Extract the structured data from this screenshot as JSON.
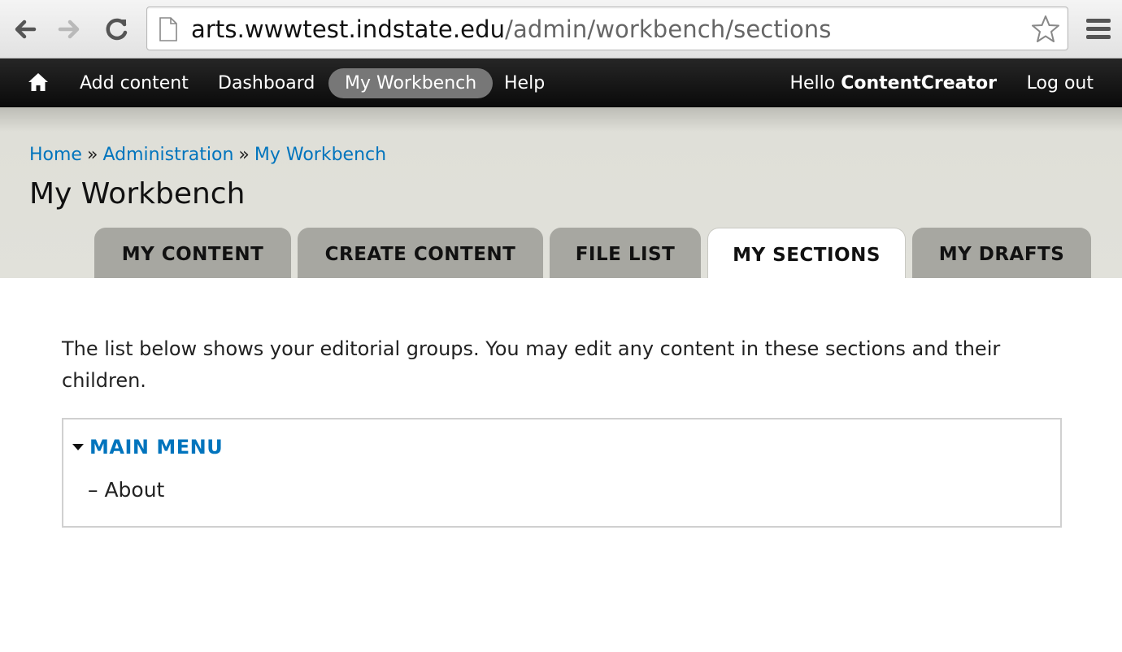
{
  "browser": {
    "url_host": "arts.wwwtest.indstate.edu",
    "url_path": "/admin/workbench/sections",
    "icons": [
      "back-arrow-icon",
      "forward-arrow-icon",
      "reload-icon",
      "page-icon",
      "star-icon",
      "hamburger-menu-icon"
    ]
  },
  "toolbar": {
    "items": [
      {
        "label": "Add content"
      },
      {
        "label": "Dashboard"
      },
      {
        "label": "My Workbench",
        "active": true
      },
      {
        "label": "Help"
      }
    ],
    "hello_prefix": "Hello",
    "username": "ContentCreator",
    "logout": "Log out"
  },
  "breadcrumb": [
    "Home",
    "Administration",
    "My Workbench"
  ],
  "breadcrumb_separator": "»",
  "page_title": "My Workbench",
  "tabs": [
    {
      "label": "MY CONTENT"
    },
    {
      "label": "CREATE CONTENT"
    },
    {
      "label": "FILE LIST"
    },
    {
      "label": "MY SECTIONS",
      "active": true
    },
    {
      "label": "MY DRAFTS"
    }
  ],
  "intro": "The list below shows your editorial groups. You may edit any content in these sections and their children.",
  "sections": {
    "menu_title": "MAIN MENU",
    "children": [
      "– About"
    ]
  },
  "colors": {
    "link": "#0074bd",
    "toolbar_bg": "#111111",
    "active_pill": "#777777",
    "header_bg": "#e1e1da",
    "tab_bg": "#a7a7a1"
  }
}
